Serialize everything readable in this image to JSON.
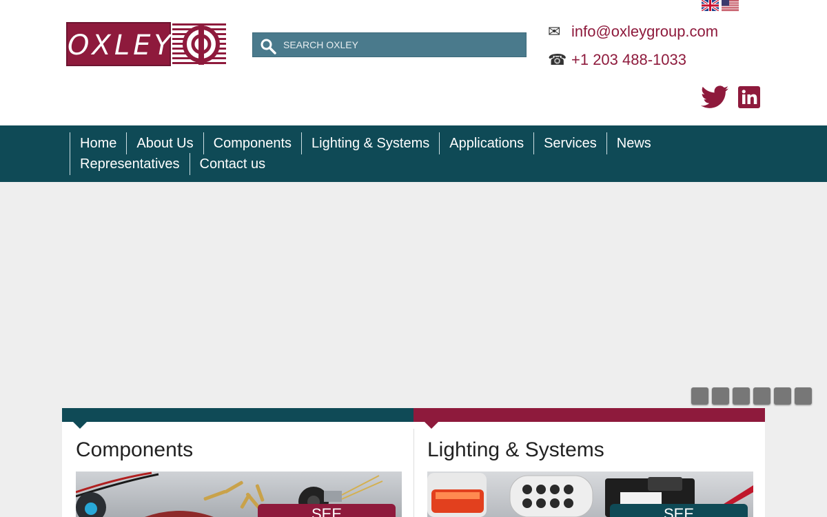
{
  "brand": {
    "logo_text": "OXLEY",
    "accent": "#8e1a3c",
    "nav_bg": "#0f4a56"
  },
  "search": {
    "placeholder": "SEARCH OXLEY",
    "value": ""
  },
  "contact": {
    "email": "info@oxleygroup.com",
    "phone": "+1 203 488-1033",
    "email_icon": "envelope-icon",
    "phone_icon": "telephone-icon"
  },
  "flags": [
    "uk-flag-icon",
    "us-flag-icon"
  ],
  "social": [
    "twitter-icon",
    "linkedin-icon"
  ],
  "nav": {
    "row1": [
      "Home",
      "About Us",
      "Components",
      "Lighting & Systems",
      "Applications",
      "Services",
      "News"
    ],
    "row2": [
      "Representatives",
      "Contact us"
    ]
  },
  "slider": {
    "dot_count": 6
  },
  "cards": [
    {
      "title": "Components",
      "button": "SEE"
    },
    {
      "title": "Lighting & Systems",
      "button": "SEE"
    }
  ]
}
